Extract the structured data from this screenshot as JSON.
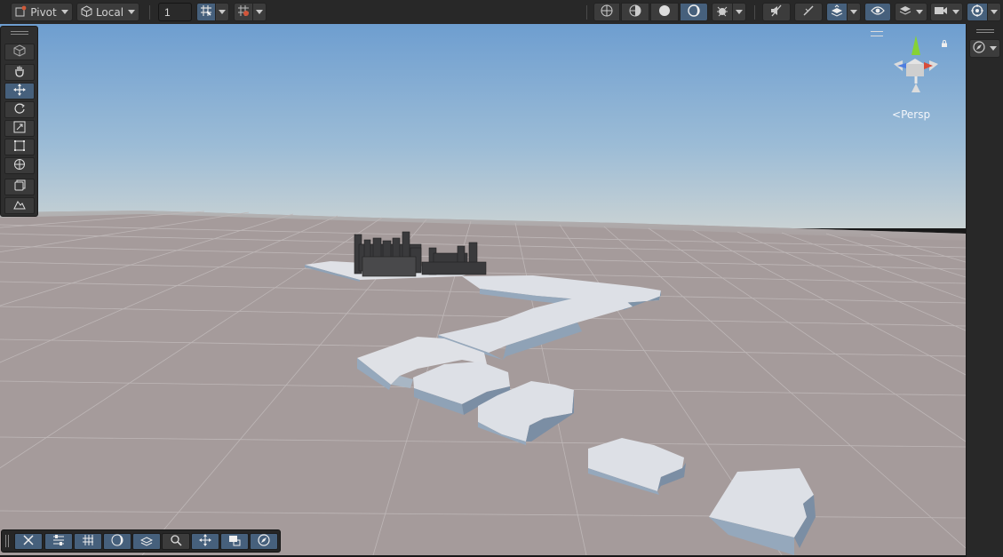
{
  "toolbar": {
    "pivot_label": "Pivot",
    "local_label": "Local",
    "increment_value": "1"
  },
  "scene": {
    "camera_mode": "Persp"
  },
  "icons": {
    "pivot": "pivot-icon",
    "local": "cube-icon",
    "grid_snap": "grid-snap-icon",
    "increment_snap": "increment-snap-icon",
    "wireframe": "wireframe-icon",
    "shaded": "shaded-icon",
    "lit": "lit-icon",
    "effects": "effects-icon",
    "audio": "audio-mute-icon",
    "fx": "fx-icon",
    "hidden_objects": "visibility-icon",
    "layers": "layers-icon",
    "camera": "camera-icon",
    "gizmos": "gizmos-icon"
  },
  "colors": {
    "accent": "#46607c",
    "toolbar_bg": "#282828",
    "sky_top": "#6e9ed0",
    "ground": "#a59b9b"
  }
}
